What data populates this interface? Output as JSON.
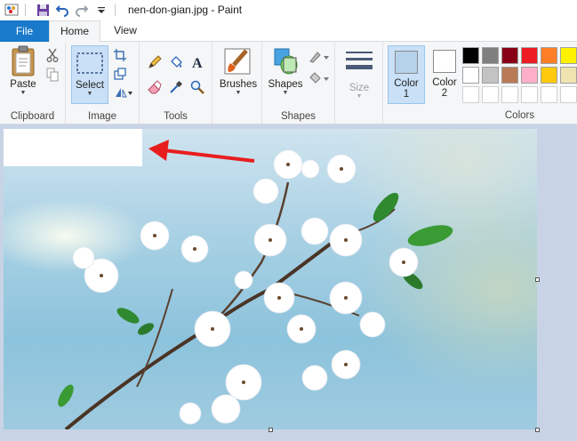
{
  "window": {
    "title": "nen-don-gian.jpg - Paint"
  },
  "quick_access": {
    "icons": [
      "paint-app-icon",
      "save-icon",
      "undo-icon",
      "redo-icon",
      "customize-dropdown-icon"
    ]
  },
  "tabs": {
    "file": "File",
    "home": "Home",
    "view": "View"
  },
  "ribbon": {
    "clipboard": {
      "label": "Clipboard",
      "paste": "Paste"
    },
    "image": {
      "label": "Image",
      "select": "Select"
    },
    "tools": {
      "label": "Tools"
    },
    "brushes": {
      "label": "Brushes"
    },
    "shapes": {
      "label": "Shapes",
      "shapes_btn": "Shapes"
    },
    "size": {
      "label": "Size"
    },
    "colors": {
      "label": "Colors",
      "color1": "Color\n1",
      "color1_line1": "Color",
      "color1_line2": "1",
      "color2_line1": "Color",
      "color2_line2": "2",
      "color1_value": "#b4d2ea",
      "color2_value": "#ffffff",
      "palette_row1": [
        "#000000",
        "#7f7f7f",
        "#880015",
        "#ed1c24",
        "#ff7f27",
        "#fff200"
      ],
      "palette_row2": [
        "#ffffff",
        "#c3c3c3",
        "#b97a57",
        "#ffaec9",
        "#ffc90e",
        "#efe4b0"
      ]
    }
  },
  "canvas": {
    "annotation_arrow_color": "#e81e1e",
    "redacted_box_color": "#ffffff"
  }
}
